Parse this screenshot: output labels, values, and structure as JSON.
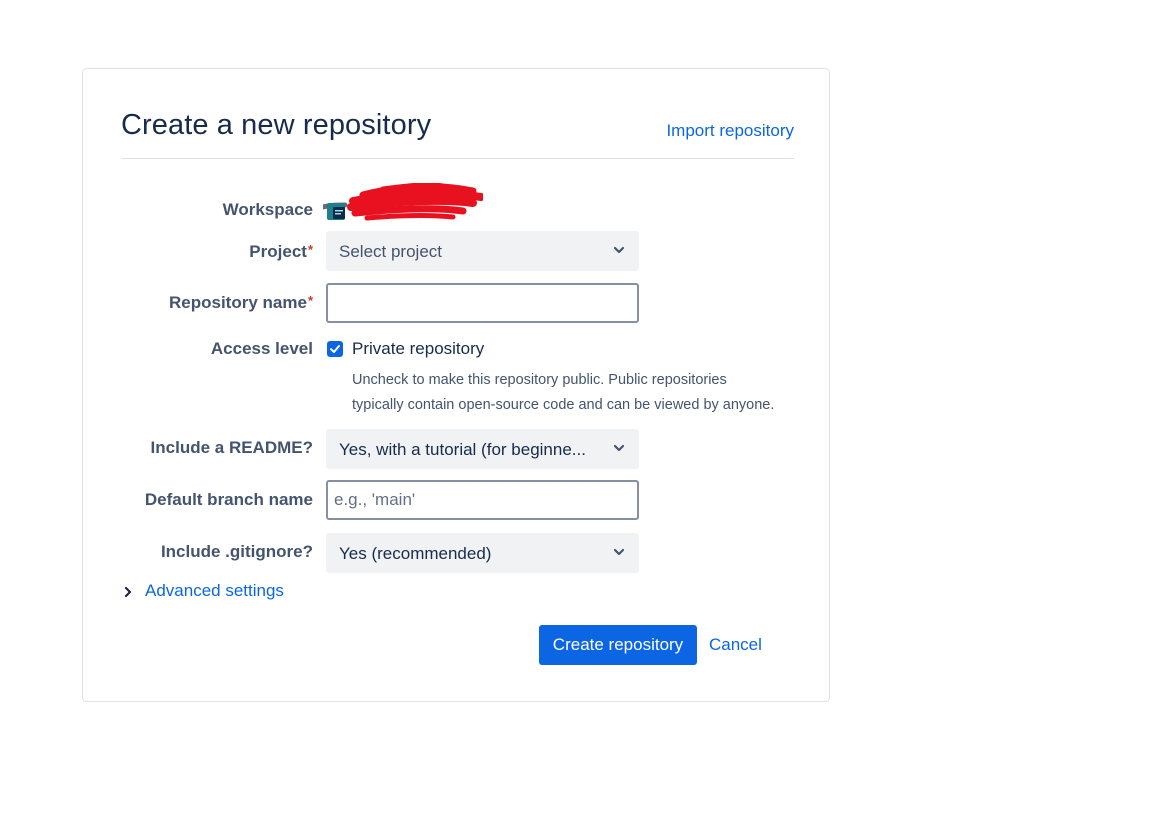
{
  "header": {
    "title": "Create a new repository",
    "import_link": "Import repository"
  },
  "form": {
    "workspace": {
      "label": "Workspace"
    },
    "project": {
      "label": "Project",
      "required_mark": "*",
      "value": "Select project"
    },
    "repository_name": {
      "label": "Repository name",
      "required_mark": "*",
      "value": ""
    },
    "access_level": {
      "label": "Access level",
      "checkbox_label": "Private repository",
      "checked": true,
      "helper_line1": "Uncheck to make this repository public. Public repositories",
      "helper_line2": "typically contain open-source code and can be viewed by anyone."
    },
    "readme": {
      "label": "Include a README?",
      "value": "Yes, with a tutorial (for beginne..."
    },
    "default_branch": {
      "label": "Default branch name",
      "placeholder": "e.g., 'main'",
      "value": ""
    },
    "gitignore": {
      "label": "Include .gitignore?",
      "value": "Yes (recommended)"
    },
    "advanced_settings": "Advanced settings"
  },
  "actions": {
    "create_label": "Create repository",
    "cancel_label": "Cancel"
  },
  "colors": {
    "accent": "#0c66e4",
    "required": "#c9372c",
    "text": "#172b4d",
    "subtle_text": "#44546f",
    "redaction": "#e8111f"
  },
  "icons": {
    "select_chevron": "chevron-down-icon",
    "advanced_chevron": "chevron-right-icon",
    "checkbox_check": "check-icon",
    "workspace_avatar": "workspace-avatar-icon"
  }
}
